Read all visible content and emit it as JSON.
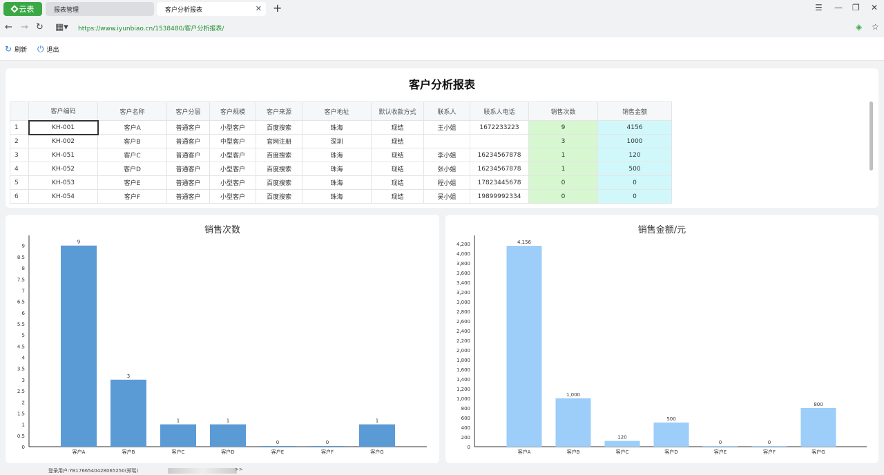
{
  "browser": {
    "app_badge": "云表",
    "tabs": [
      {
        "label": "报表管理"
      },
      {
        "label": "客户分析报表"
      }
    ],
    "url": "https://www.iyunbiao.cn/1538480/客户分析报表/"
  },
  "toolbar": {
    "refresh_label": "刷新",
    "exit_label": "退出"
  },
  "report": {
    "title": "客户分析报表",
    "columns": [
      "客户编码",
      "客户名称",
      "客户分层",
      "客户规模",
      "客户来源",
      "客户地址",
      "默认收款方式",
      "联系人",
      "联系人电话",
      "销售次数",
      "销售金额"
    ],
    "rows": [
      {
        "n": "1",
        "cells": [
          "KH-001",
          "客户A",
          "普通客户",
          "小型客户",
          "百度搜索",
          "珠海",
          "现结",
          "王小姐",
          "1672233223",
          "9",
          "4156"
        ]
      },
      {
        "n": "2",
        "cells": [
          "KH-002",
          "客户B",
          "普通客户",
          "中型客户",
          "官网注册",
          "深圳",
          "现结",
          "",
          "",
          "3",
          "1000"
        ]
      },
      {
        "n": "3",
        "cells": [
          "KH-051",
          "客户C",
          "普通客户",
          "小型客户",
          "百度搜索",
          "珠海",
          "现结",
          "李小姐",
          "16234567878",
          "1",
          "120"
        ]
      },
      {
        "n": "4",
        "cells": [
          "KH-052",
          "客户D",
          "普通客户",
          "小型客户",
          "百度搜索",
          "珠海",
          "现结",
          "张小姐",
          "16234567878",
          "1",
          "500"
        ]
      },
      {
        "n": "5",
        "cells": [
          "KH-053",
          "客户E",
          "普通客户",
          "小型客户",
          "百度搜索",
          "珠海",
          "现结",
          "程小姐",
          "17823445678",
          "0",
          "0"
        ]
      },
      {
        "n": "6",
        "cells": [
          "KH-054",
          "客户F",
          "普通客户",
          "小型客户",
          "百度搜索",
          "珠海",
          "现结",
          "吴小姐",
          "19899992334",
          "0",
          "0"
        ]
      }
    ]
  },
  "chart_data": [
    {
      "type": "bar",
      "title": "销售次数",
      "categories": [
        "客户A",
        "客户B",
        "客户C",
        "客户D",
        "客户E",
        "客户F",
        "客户G"
      ],
      "values": [
        9,
        3,
        1,
        1,
        0,
        0,
        1
      ],
      "value_labels": [
        "9",
        "3",
        "1",
        "1",
        "0",
        "0",
        "1"
      ],
      "yticks": [
        "0",
        "0.5",
        "1",
        "1.5",
        "2",
        "2.5",
        "3",
        "3.5",
        "4",
        "4.5",
        "5",
        "5.5",
        "6",
        "6.5",
        "7",
        "7.5",
        "8",
        "8.5",
        "9"
      ],
      "ylim": [
        0,
        9.3
      ],
      "color": "#5b9bd5",
      "grid": false
    },
    {
      "type": "bar",
      "title": "销售金额/元",
      "categories": [
        "客户A",
        "客户B",
        "客户C",
        "客户D",
        "客户E",
        "客户F",
        "客户G"
      ],
      "values": [
        4156,
        1000,
        120,
        500,
        0,
        0,
        800
      ],
      "value_labels": [
        "4,156",
        "1,000",
        "120",
        "500",
        "0",
        "0",
        "800"
      ],
      "yticks": [
        "0",
        "200",
        "400",
        "600",
        "800",
        "1,000",
        "1,200",
        "1,400",
        "1,600",
        "1,800",
        "2,000",
        "2,200",
        "2,400",
        "2,600",
        "2,800",
        "3,000",
        "3,200",
        "3,400",
        "3,600",
        "3,800",
        "4,000",
        "4,200"
      ],
      "ylim": [
        0,
        4300
      ],
      "color": "#9dcdf9",
      "grid": false
    }
  ],
  "status": {
    "user_text": "登录用户:YB1766540428065250(郑瑶)",
    "more": ">>"
  },
  "colors": {
    "brand": "#3aa845",
    "url": "#1f8f2f",
    "count_cell_bg": "#d6f7d0",
    "amount_cell_bg": "#d0f8fb"
  },
  "icons": [
    "app-diamond-icon",
    "close-icon",
    "plus-icon",
    "menu-icon",
    "minimize-icon",
    "restore-icon",
    "window-close-icon",
    "back-icon",
    "forward-icon",
    "reload-icon",
    "apps-icon",
    "extension-icon",
    "star-icon",
    "refresh-icon",
    "power-icon"
  ]
}
